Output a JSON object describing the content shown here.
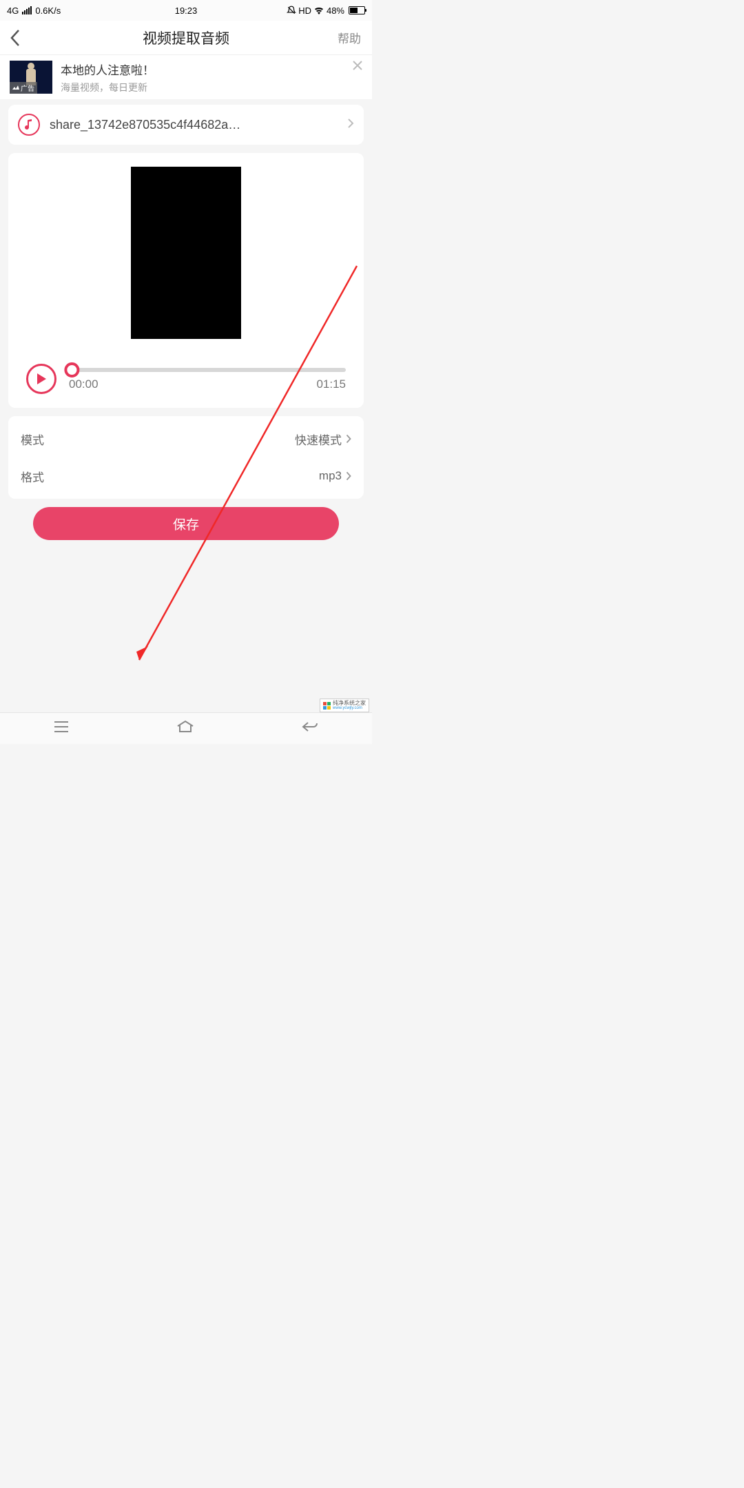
{
  "status_bar": {
    "network_type": "4G",
    "speed": "0.6K/s",
    "time": "19:23",
    "hd": "HD",
    "battery_pct": "48%"
  },
  "header": {
    "title": "视频提取音频",
    "help": "帮助"
  },
  "ad": {
    "title": "本地的人注意啦！",
    "subtitle": "海量视频，每日更新",
    "tag": "广告"
  },
  "file": {
    "name": "share_13742e870535c4f44682a…"
  },
  "player": {
    "current_time": "00:00",
    "total_time": "01:15"
  },
  "settings": {
    "mode_label": "模式",
    "mode_value": "快速模式",
    "format_label": "格式",
    "format_value": "mp3"
  },
  "save_label": "保存",
  "watermark": {
    "name": "纯净系统之家",
    "url": "www.ycwjly.com"
  },
  "colors": {
    "accent": "#e6365a",
    "button": "#e84468"
  }
}
